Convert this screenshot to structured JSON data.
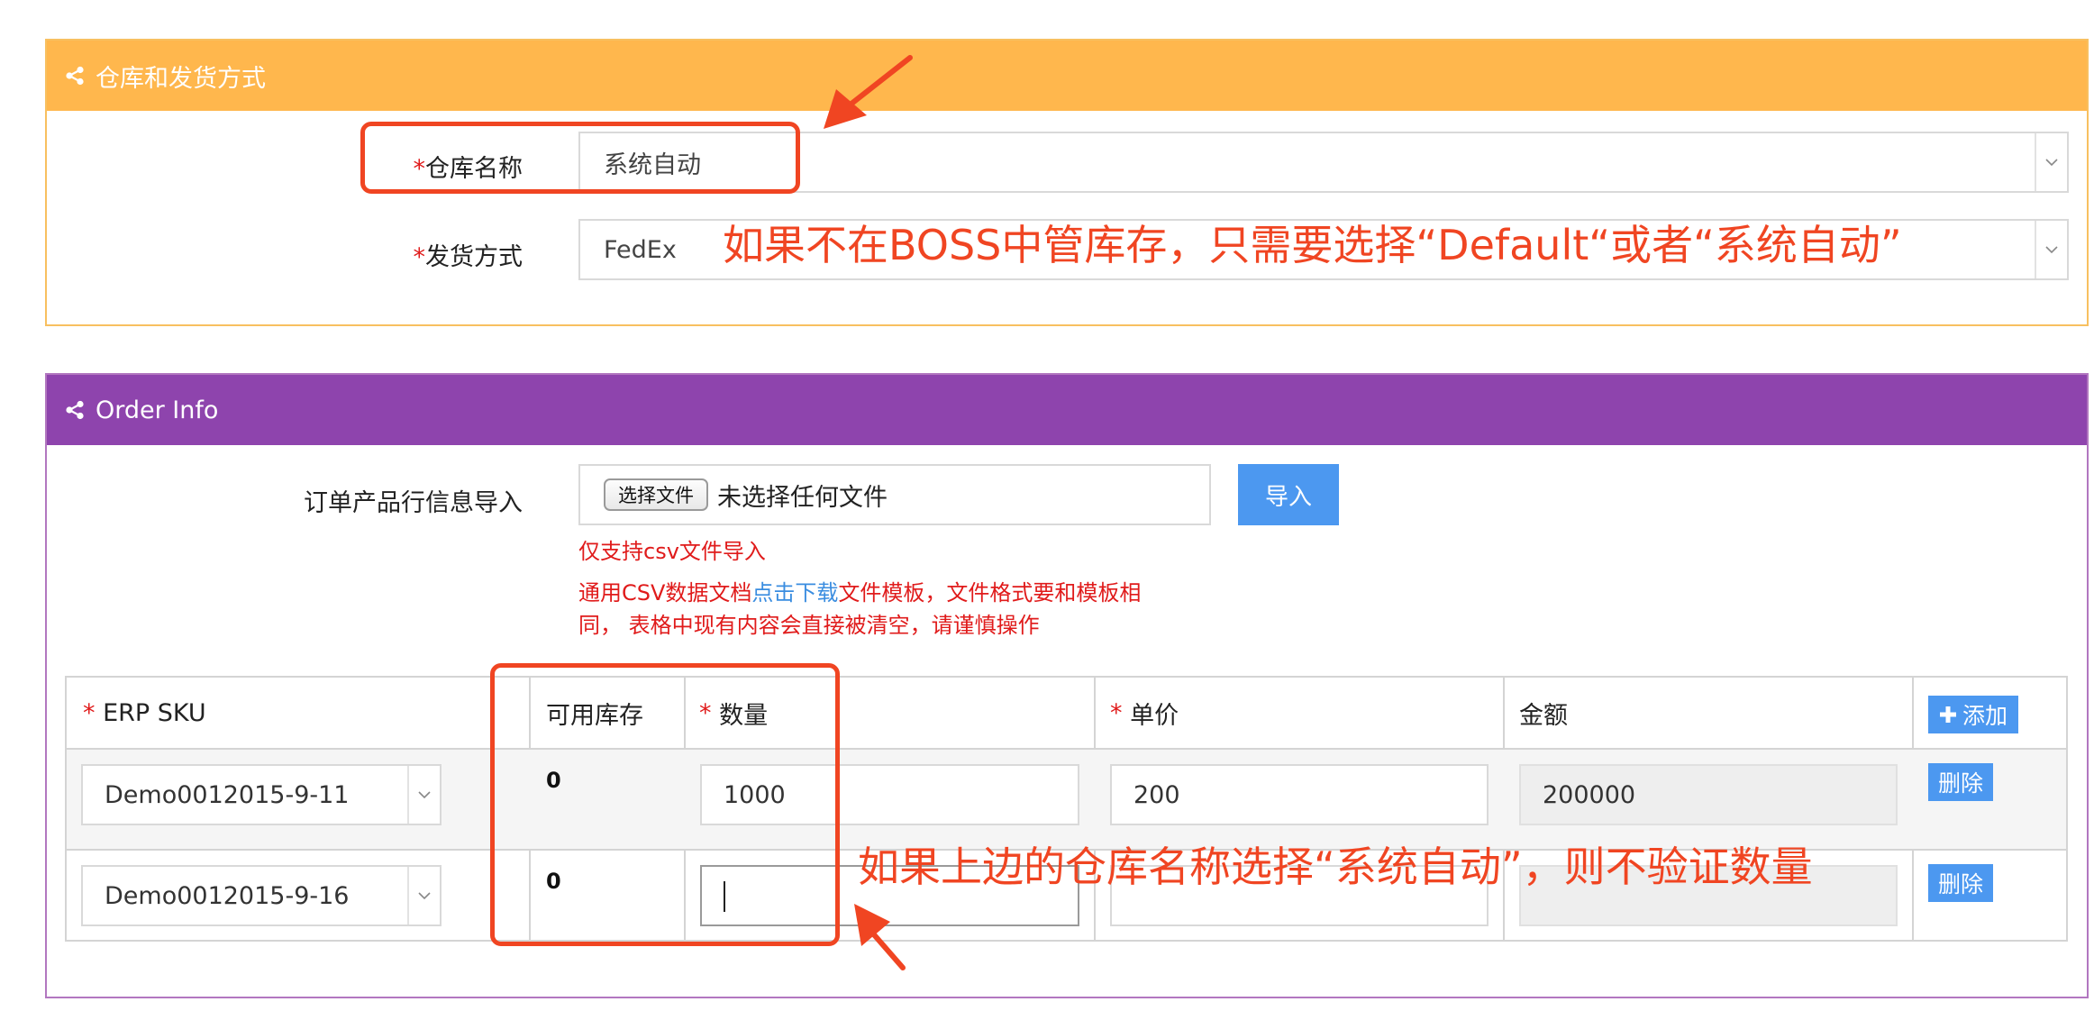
{
  "warehouse_panel": {
    "title": "仓库和发货方式",
    "warehouse_label": "仓库名称",
    "warehouse_value": "系统自动",
    "shipping_label": "发货方式",
    "shipping_value": "FedEx",
    "required_mark": "*"
  },
  "order_panel": {
    "title": "Order Info",
    "import_label": "订单产品行信息导入",
    "file_button_label": "选择文件",
    "file_none_text": "未选择任何文件",
    "import_button": "导入",
    "hint_csv_only": "仅支持csv文件导入",
    "hint_line1_pre": "通用CSV数据文档",
    "hint_link": "点击下载",
    "hint_line1_post": "文件模板，文件格式要和模板相",
    "hint_line2": "同， 表格中现有内容会直接被清空，请谨慎操作"
  },
  "table": {
    "columns": {
      "sku": "ERP SKU",
      "stock": "可用库存",
      "qty": "数量",
      "price": "单价",
      "amount": "金额"
    },
    "add_button": "添加",
    "delete_button": "删除",
    "rows": [
      {
        "sku": "Demo0012015-9-11",
        "stock": "0",
        "qty": "1000",
        "price": "200",
        "amount": "200000"
      },
      {
        "sku": "Demo0012015-9-16",
        "stock": "0",
        "qty": "",
        "price": "",
        "amount": ""
      }
    ]
  },
  "annotations": {
    "top_note": "如果不在BOSS中管库存，只需要选择“Default“或者“系统自动”",
    "bottom_note": "如果上边的仓库名称选择“系统自动”，则不验证数量"
  },
  "colors": {
    "warehouse_header": "#ffb74d",
    "order_header": "#8e44ad",
    "annotation": "#f04522",
    "button_blue": "#4c98f0",
    "required": "#e01b1b"
  }
}
